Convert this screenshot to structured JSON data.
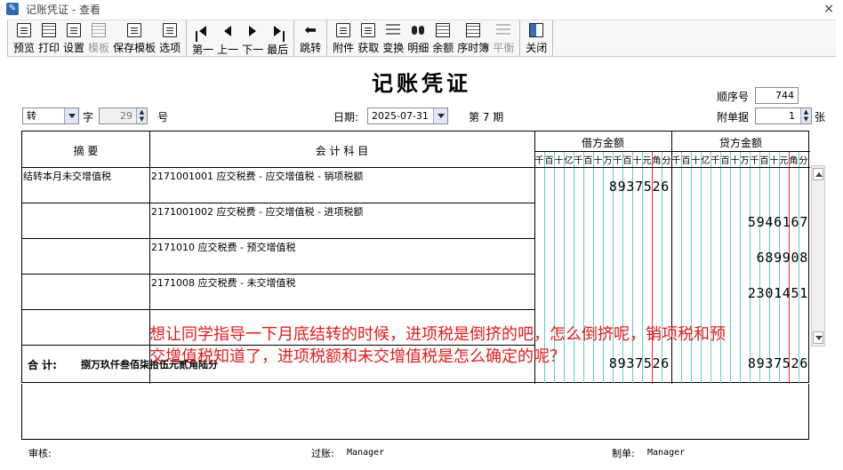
{
  "window": {
    "title": "记账凭证 - 查看",
    "close_glyph": "×"
  },
  "toolbar": {
    "groups": [
      [
        {
          "key": "preview",
          "label": "预览",
          "icon": "preview-icon"
        },
        {
          "key": "print",
          "label": "打印",
          "icon": "printer-icon"
        },
        {
          "key": "setup",
          "label": "设置",
          "icon": "settings-icon"
        },
        {
          "key": "template",
          "label": "模板",
          "icon": "template-icon",
          "disabled": true
        },
        {
          "key": "save_template",
          "label": "保存模板",
          "icon": "save-template-icon"
        },
        {
          "key": "options",
          "label": "选项",
          "icon": "options-icon"
        }
      ],
      [
        {
          "key": "first",
          "label": "第一",
          "icon": "first-icon"
        },
        {
          "key": "prev",
          "label": "上一",
          "icon": "prev-icon"
        },
        {
          "key": "next",
          "label": "下一",
          "icon": "next-icon"
        },
        {
          "key": "last",
          "label": "最后",
          "icon": "last-icon"
        }
      ],
      [
        {
          "key": "jump",
          "label": "跳转",
          "icon": "jump-icon"
        }
      ],
      [
        {
          "key": "attach",
          "label": "附件",
          "icon": "attachment-icon"
        },
        {
          "key": "fetch",
          "label": "获取",
          "icon": "fetch-icon"
        },
        {
          "key": "swap",
          "label": "变换",
          "icon": "swap-icon"
        },
        {
          "key": "detail",
          "label": "明细",
          "icon": "binoculars-icon"
        },
        {
          "key": "balance",
          "label": "余额",
          "icon": "balance-icon"
        },
        {
          "key": "sequence_book",
          "label": "序时簿",
          "icon": "sequence-book-icon"
        },
        {
          "key": "balance_check",
          "label": "平衡",
          "icon": "balance-check-icon",
          "disabled": true
        }
      ],
      [
        {
          "key": "close",
          "label": "关闭",
          "icon": "exit-icon"
        }
      ]
    ]
  },
  "voucher": {
    "title": "记账凭证",
    "seq_label": "顺序号",
    "seq_value": "744",
    "type_value": "转",
    "zi_label": "字",
    "number_value": "29",
    "hao_label": "号",
    "date_label": "日期:",
    "date_value": "2025-07-31",
    "period_label": "第 7 期",
    "attach_label": "附单据",
    "attach_value": "1",
    "zhang_label": "张"
  },
  "grid": {
    "col_summary": "摘  要",
    "col_account": "会 计 科 目",
    "col_debit": "借方金额",
    "col_credit": "贷方金额",
    "digit_headers": [
      "千",
      "百",
      "十",
      "亿",
      "千",
      "百",
      "十",
      "万",
      "千",
      "百",
      "十",
      "元",
      "角",
      "分"
    ],
    "rows": [
      {
        "summary": "结转本月未交增值税",
        "account": "2171001001 应交税费 - 应交增值税 - 销项税额",
        "debit": "8937526",
        "credit": ""
      },
      {
        "summary": "",
        "account": "2171001002 应交税费 - 应交增值税 - 进项税额",
        "debit": "",
        "credit": "5946167"
      },
      {
        "summary": "",
        "account": "2171010 应交税费 - 预交增值税",
        "debit": "",
        "credit": "689908"
      },
      {
        "summary": "",
        "account": "2171008 应交税费 - 未交增值税",
        "debit": "",
        "credit": "2301451"
      },
      {
        "summary": "",
        "account": "",
        "debit": "",
        "credit": ""
      }
    ],
    "total_label": "合  计:",
    "total_words": "捌万玖仟叁佰柒拾伍元贰角陆分",
    "total_debit": "8937526",
    "total_credit": "8937526"
  },
  "overlay": {
    "line1": "想让同学指导一下月底结转的时候，进项税是倒挤的吧，怎么倒挤呢，销项税和预",
    "line2": "交增值税知道了，进项税额和未交增值税是怎么确定的呢？"
  },
  "footer": {
    "audit_label": "审核:",
    "posting_label": "过账:",
    "posting_value": "Manager",
    "maker_label": "制单:",
    "maker_value": "Manager"
  },
  "colors": {
    "overlay_text": "#e51b1b",
    "column_teal": "#66cccc",
    "column_red": "#dd3333"
  }
}
